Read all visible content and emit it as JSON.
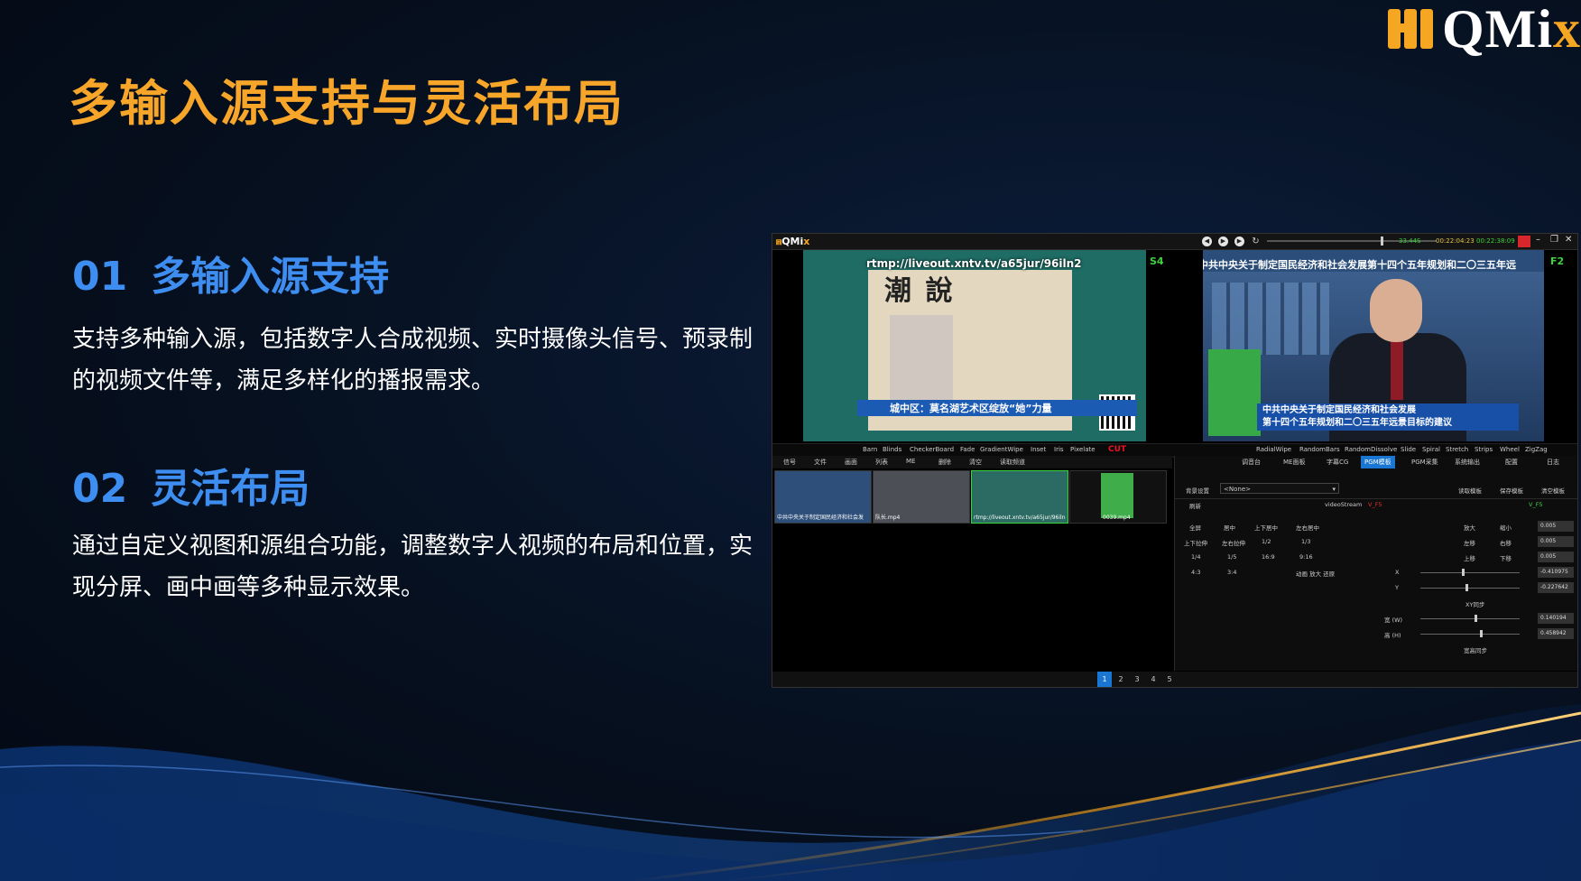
{
  "logo": {
    "text_main": "QMi",
    "text_accent": "x"
  },
  "slide": {
    "title": "多输入源支持与灵活布局",
    "sections": [
      {
        "num": "01",
        "heading": "多输入源支持",
        "body": "支持多种输入源，包括数字人合成视频、实时摄像头信号、预录制的视频文件等，满足多样化的播报需求。"
      },
      {
        "num": "02",
        "heading": "灵活布局",
        "body": "通过自定义视图和源组合功能，调整数字人视频的布局和位置，实现分屏、画中画等多种显示效果。"
      }
    ]
  },
  "app": {
    "brand_main": "QMi",
    "brand_accent": "x",
    "times": {
      "t1": "33.44S",
      "t2": "00:22:04:23",
      "t3": "00:22:38:09"
    },
    "preview_left": {
      "slot": "S4",
      "url": "rtmp://liveout.xntv.tv/a65jur/96iln2",
      "poster_title": "潮 說",
      "lower_third": "城中区：莫名湖艺术区绽放“她”力量"
    },
    "preview_right": {
      "slot": "F2",
      "headline": "中共中央关于制定国民经济和社会发展第十四个五年规划和二〇三五年远",
      "lower_line1": "中共中央关于制定国民经济和社会发展",
      "lower_line2": "第十四个五年规划和二〇三五年远景目标的建议"
    },
    "transitions_left": [
      "Barn",
      "Blinds",
      "CheckerBoard",
      "Fade",
      "GradientWipe",
      "Inset",
      "Iris",
      "Pixelate"
    ],
    "cut_label": "CUT",
    "transitions_right": [
      "RadialWipe",
      "RandomBars",
      "RandomDissolve",
      "Slide",
      "Spiral",
      "Stretch",
      "Strips",
      "Wheel",
      "ZigZag"
    ],
    "left_tabs": [
      "信号",
      "文件",
      "画面",
      "列表",
      "ME",
      "删除",
      "清空",
      "读取频道"
    ],
    "thumbs": [
      {
        "label": "中共中央关于制定国民经济和社会发"
      },
      {
        "label": "队长.mp4"
      },
      {
        "label": "rtmp://liveout.xntv.tv/a65jur/96iln"
      },
      {
        "label": "0039.mp4"
      }
    ],
    "right_tabs": [
      "调音台",
      "ME面板",
      "字幕CG",
      "PGM模板",
      "PGM采集",
      "系统输出",
      "配置",
      "日志"
    ],
    "active_right_tab": "PGM模板",
    "bg_setting_label": "背景设置",
    "bg_setting_value": "<None>",
    "template_buttons": [
      "读取模板",
      "保存模板",
      "清空模板"
    ],
    "refresh_label": "刷新",
    "stream_label": "videoStream",
    "stream_tag_red": "V_F5",
    "stream_tag_green": "V_F5",
    "layout_grid": [
      [
        "全屏",
        "居中",
        "上下居中",
        "左右居中"
      ],
      [
        "上下拉伸",
        "左右拉伸",
        "1/2",
        "1/3"
      ],
      [
        "1/4",
        "1/5",
        "16:9",
        "9:16"
      ],
      [
        "4:3",
        "3:4",
        "动画 放大 还原",
        ""
      ]
    ],
    "pos_controls": {
      "zoom_in": "放大",
      "zoom_out": "缩小",
      "move_left": "左移",
      "move_right": "右移",
      "move_up": "上移",
      "move_down": "下移",
      "step1": "0.005",
      "step2": "0.005",
      "step3": "0.005",
      "x_label": "X",
      "x_value": "-0.410975",
      "y_label": "Y",
      "y_value": "-0.227642",
      "xy_sync": "XY同步",
      "w_label": "宽 (W)",
      "w_value": "0.140194",
      "h_label": "高 (H)",
      "h_value": "0.458942",
      "wh_sync": "宽高同步"
    },
    "pages": [
      "1",
      "2",
      "3",
      "4",
      "5"
    ],
    "active_page": "1"
  }
}
